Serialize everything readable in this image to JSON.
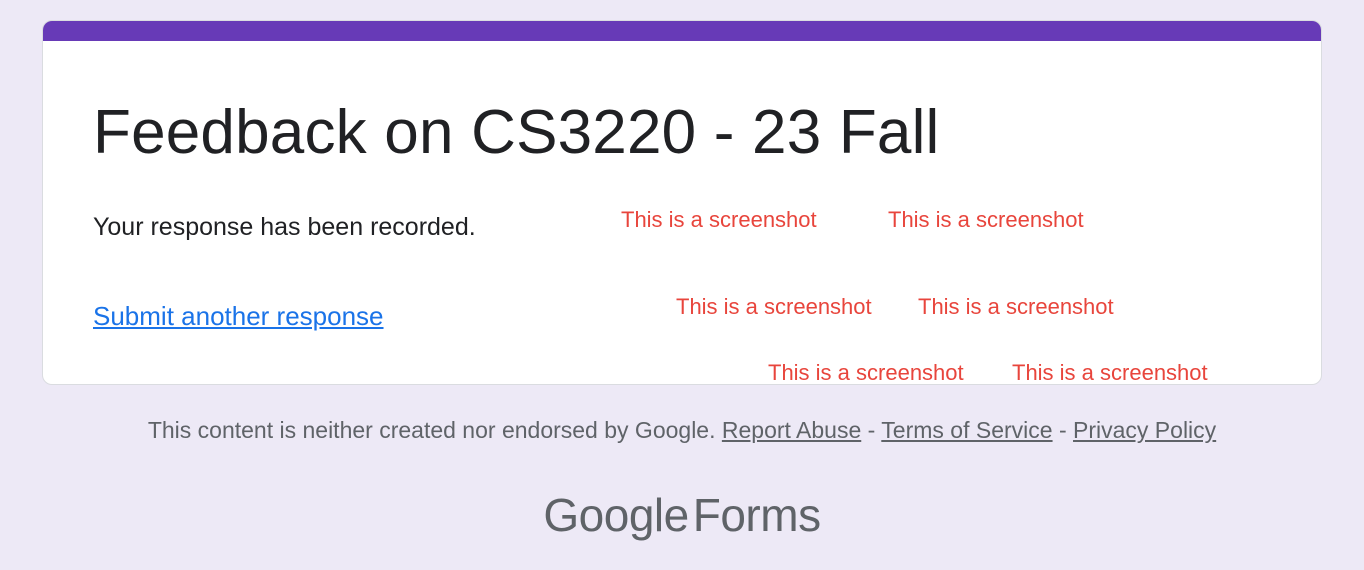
{
  "form": {
    "title": "Feedback on CS3220 - 23 Fall",
    "confirmation": "Your response has been recorded.",
    "submit_another_label": "Submit another response",
    "accent_color": "#673ab7"
  },
  "watermarks": [
    "This is a screenshot",
    "This is a screenshot",
    "This is a screenshot",
    "This is a screenshot",
    "This is a screenshot",
    "This is a screenshot"
  ],
  "footer": {
    "disclaimer": "This content is neither created nor endorsed by Google.",
    "report_abuse": "Report Abuse",
    "separator": "-",
    "terms": "Terms of Service",
    "privacy": "Privacy Policy"
  },
  "brand": {
    "google": "Google",
    "product": "Forms"
  },
  "colors": {
    "background": "#ede9f6",
    "link": "#1a73e8",
    "watermark": "#e8453c"
  }
}
